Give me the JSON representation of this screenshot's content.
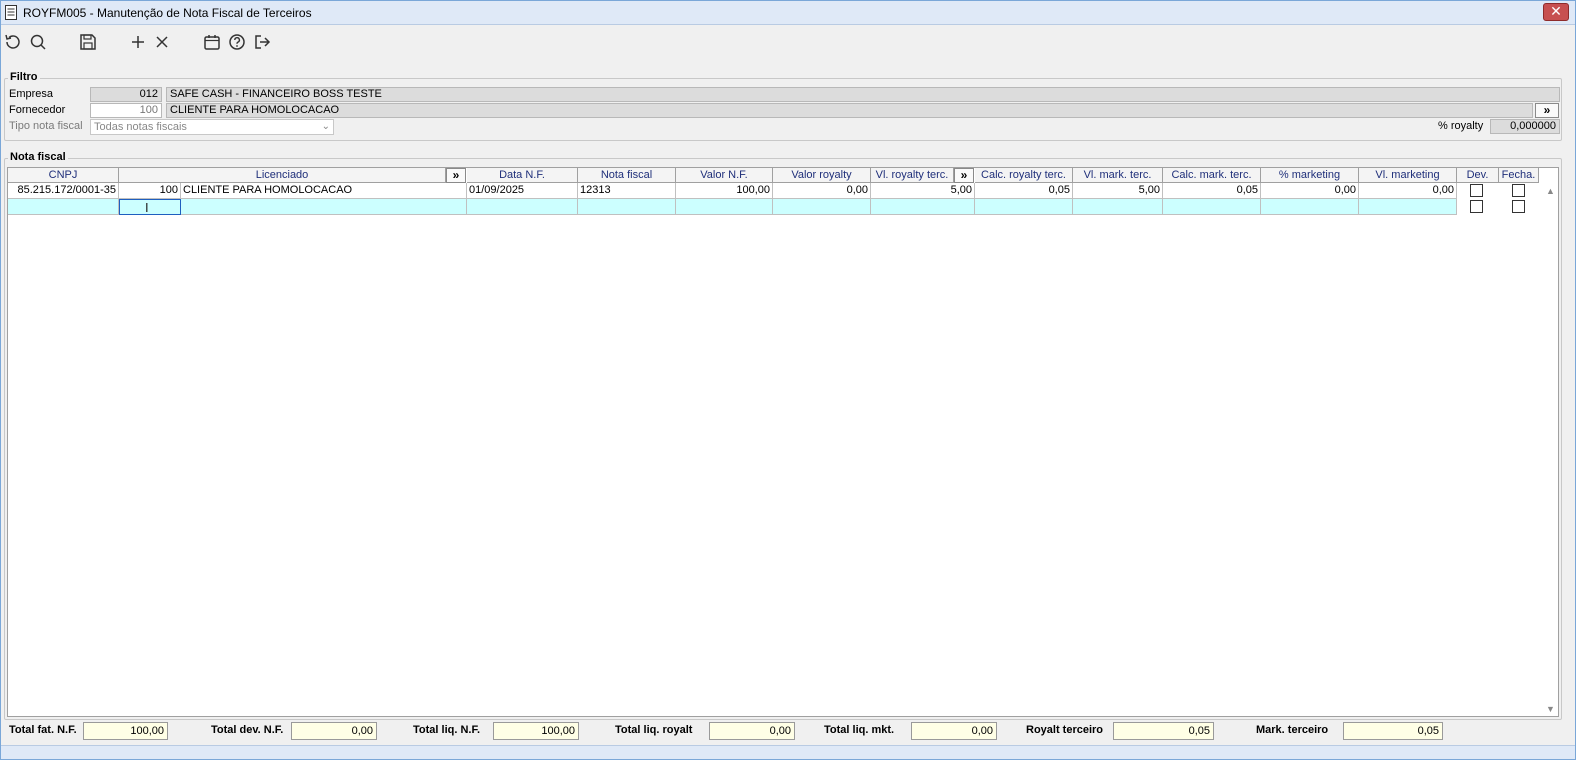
{
  "window": {
    "title": "ROYFM005 - Manutenção de Nota Fiscal de Terceiros",
    "close": "✕"
  },
  "filtro": {
    "legend": "Filtro",
    "empresa_label": "Empresa",
    "empresa_code": "012",
    "empresa_name": "SAFE CASH - FINANCEIRO BOSS TESTE",
    "fornecedor_label": "Fornecedor",
    "fornecedor_code": "100",
    "fornecedor_name": "CLIENTE PARA HOMOLOCACAO",
    "more": "»",
    "tipo_label": "Tipo nota fiscal",
    "tipo_value": "Todas notas fiscais",
    "royalty_label": "% royalty",
    "royalty_value": "0,000000"
  },
  "nota": {
    "legend": "Nota fiscal",
    "more": "»",
    "headers": {
      "cnpj": "CNPJ",
      "licenciado": "Licenciado",
      "data": "Data N.F.",
      "nota": "Nota fiscal",
      "valor": "Valor N.F.",
      "valor_royalty": "Valor royalty",
      "vl_royalty_terc": "Vl. royalty terc.",
      "calc_royalty_terc": "Calc. royalty terc.",
      "vl_mark_terc": "Vl. mark. terc.",
      "calc_mark_terc": "Calc. mark. terc.",
      "pct_marketing": "% marketing",
      "vl_marketing": "Vl. marketing",
      "dev": "Dev.",
      "fecha": "Fecha."
    },
    "rows": [
      {
        "cnpj": "85.215.172/0001-35",
        "lic_code": "100",
        "lic_name": "CLIENTE PARA HOMOLOCACAO",
        "data": "01/09/2025",
        "nota": "12313",
        "valor": "100,00",
        "valor_royalty": "0,00",
        "vl_royalty_terc": "5,00",
        "calc_royalty_terc": "0,05",
        "vl_mark_terc": "5,00",
        "calc_mark_terc": "0,05",
        "pct_marketing": "0,00",
        "vl_marketing": "0,00"
      }
    ]
  },
  "totals": {
    "fat_label": "Total fat. N.F.",
    "fat_value": "100,00",
    "dev_label": "Total dev. N.F.",
    "dev_value": "0,00",
    "liq_label": "Total liq. N.F.",
    "liq_value": "100,00",
    "liq_royalt_label": "Total liq. royalt",
    "liq_royalt_value": "0,00",
    "liq_mkt_label": "Total liq. mkt.",
    "liq_mkt_value": "0,00",
    "royalt_terc_label": "Royalt terceiro",
    "royalt_terc_value": "0,05",
    "mark_terc_label": "Mark. terceiro",
    "mark_terc_value": "0,05"
  }
}
